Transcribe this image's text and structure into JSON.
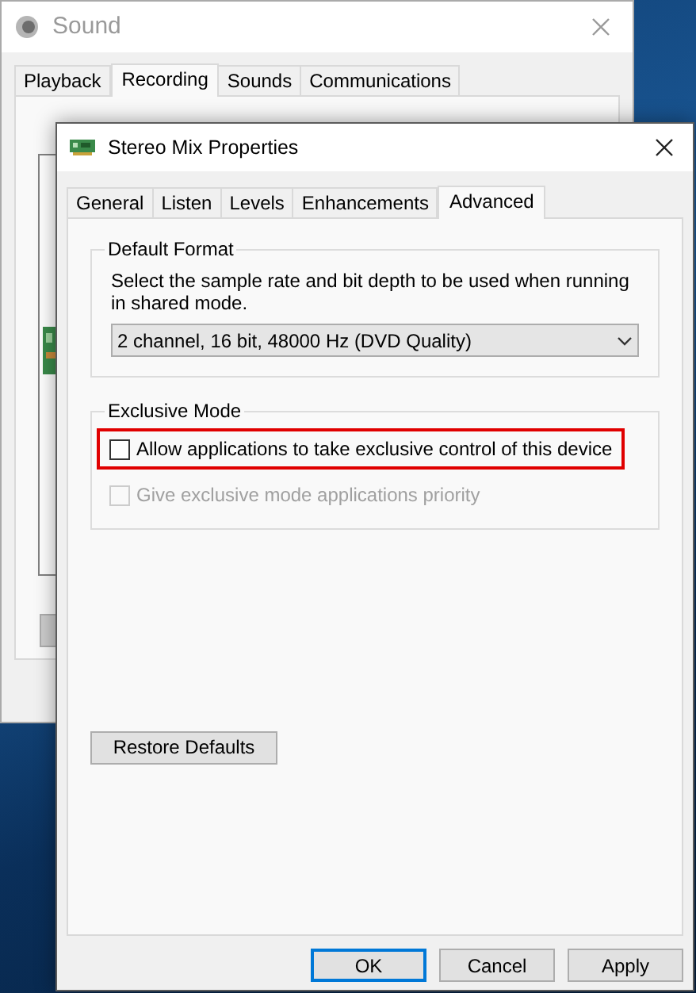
{
  "sound_window": {
    "title": "Sound",
    "tabs": [
      {
        "label": "Playback",
        "selected": false
      },
      {
        "label": "Recording",
        "selected": true
      },
      {
        "label": "Sounds",
        "selected": false
      },
      {
        "label": "Communications",
        "selected": false
      }
    ]
  },
  "dialog": {
    "title": "Stereo Mix Properties",
    "tabs": [
      {
        "label": "General",
        "selected": false
      },
      {
        "label": "Listen",
        "selected": false
      },
      {
        "label": "Levels",
        "selected": false
      },
      {
        "label": "Enhancements",
        "selected": false
      },
      {
        "label": "Advanced",
        "selected": true
      }
    ],
    "default_format": {
      "heading": "Default Format",
      "description": "Select the sample rate and bit depth to be used when running in shared mode.",
      "format": "2 channel, 16 bit, 48000 Hz (DVD Quality)"
    },
    "exclusive_mode": {
      "heading": "Exclusive Mode",
      "options": [
        {
          "label": "Allow applications to take exclusive control of this device",
          "checked": false,
          "disabled": false,
          "highlighted": true
        },
        {
          "label": "Give exclusive mode applications priority",
          "checked": false,
          "disabled": true,
          "highlighted": false
        }
      ]
    },
    "restore_button": "Restore Defaults",
    "buttons": [
      {
        "label": "OK",
        "default": true
      },
      {
        "label": "Cancel",
        "default": false
      },
      {
        "label": "Apply",
        "default": false
      }
    ]
  }
}
